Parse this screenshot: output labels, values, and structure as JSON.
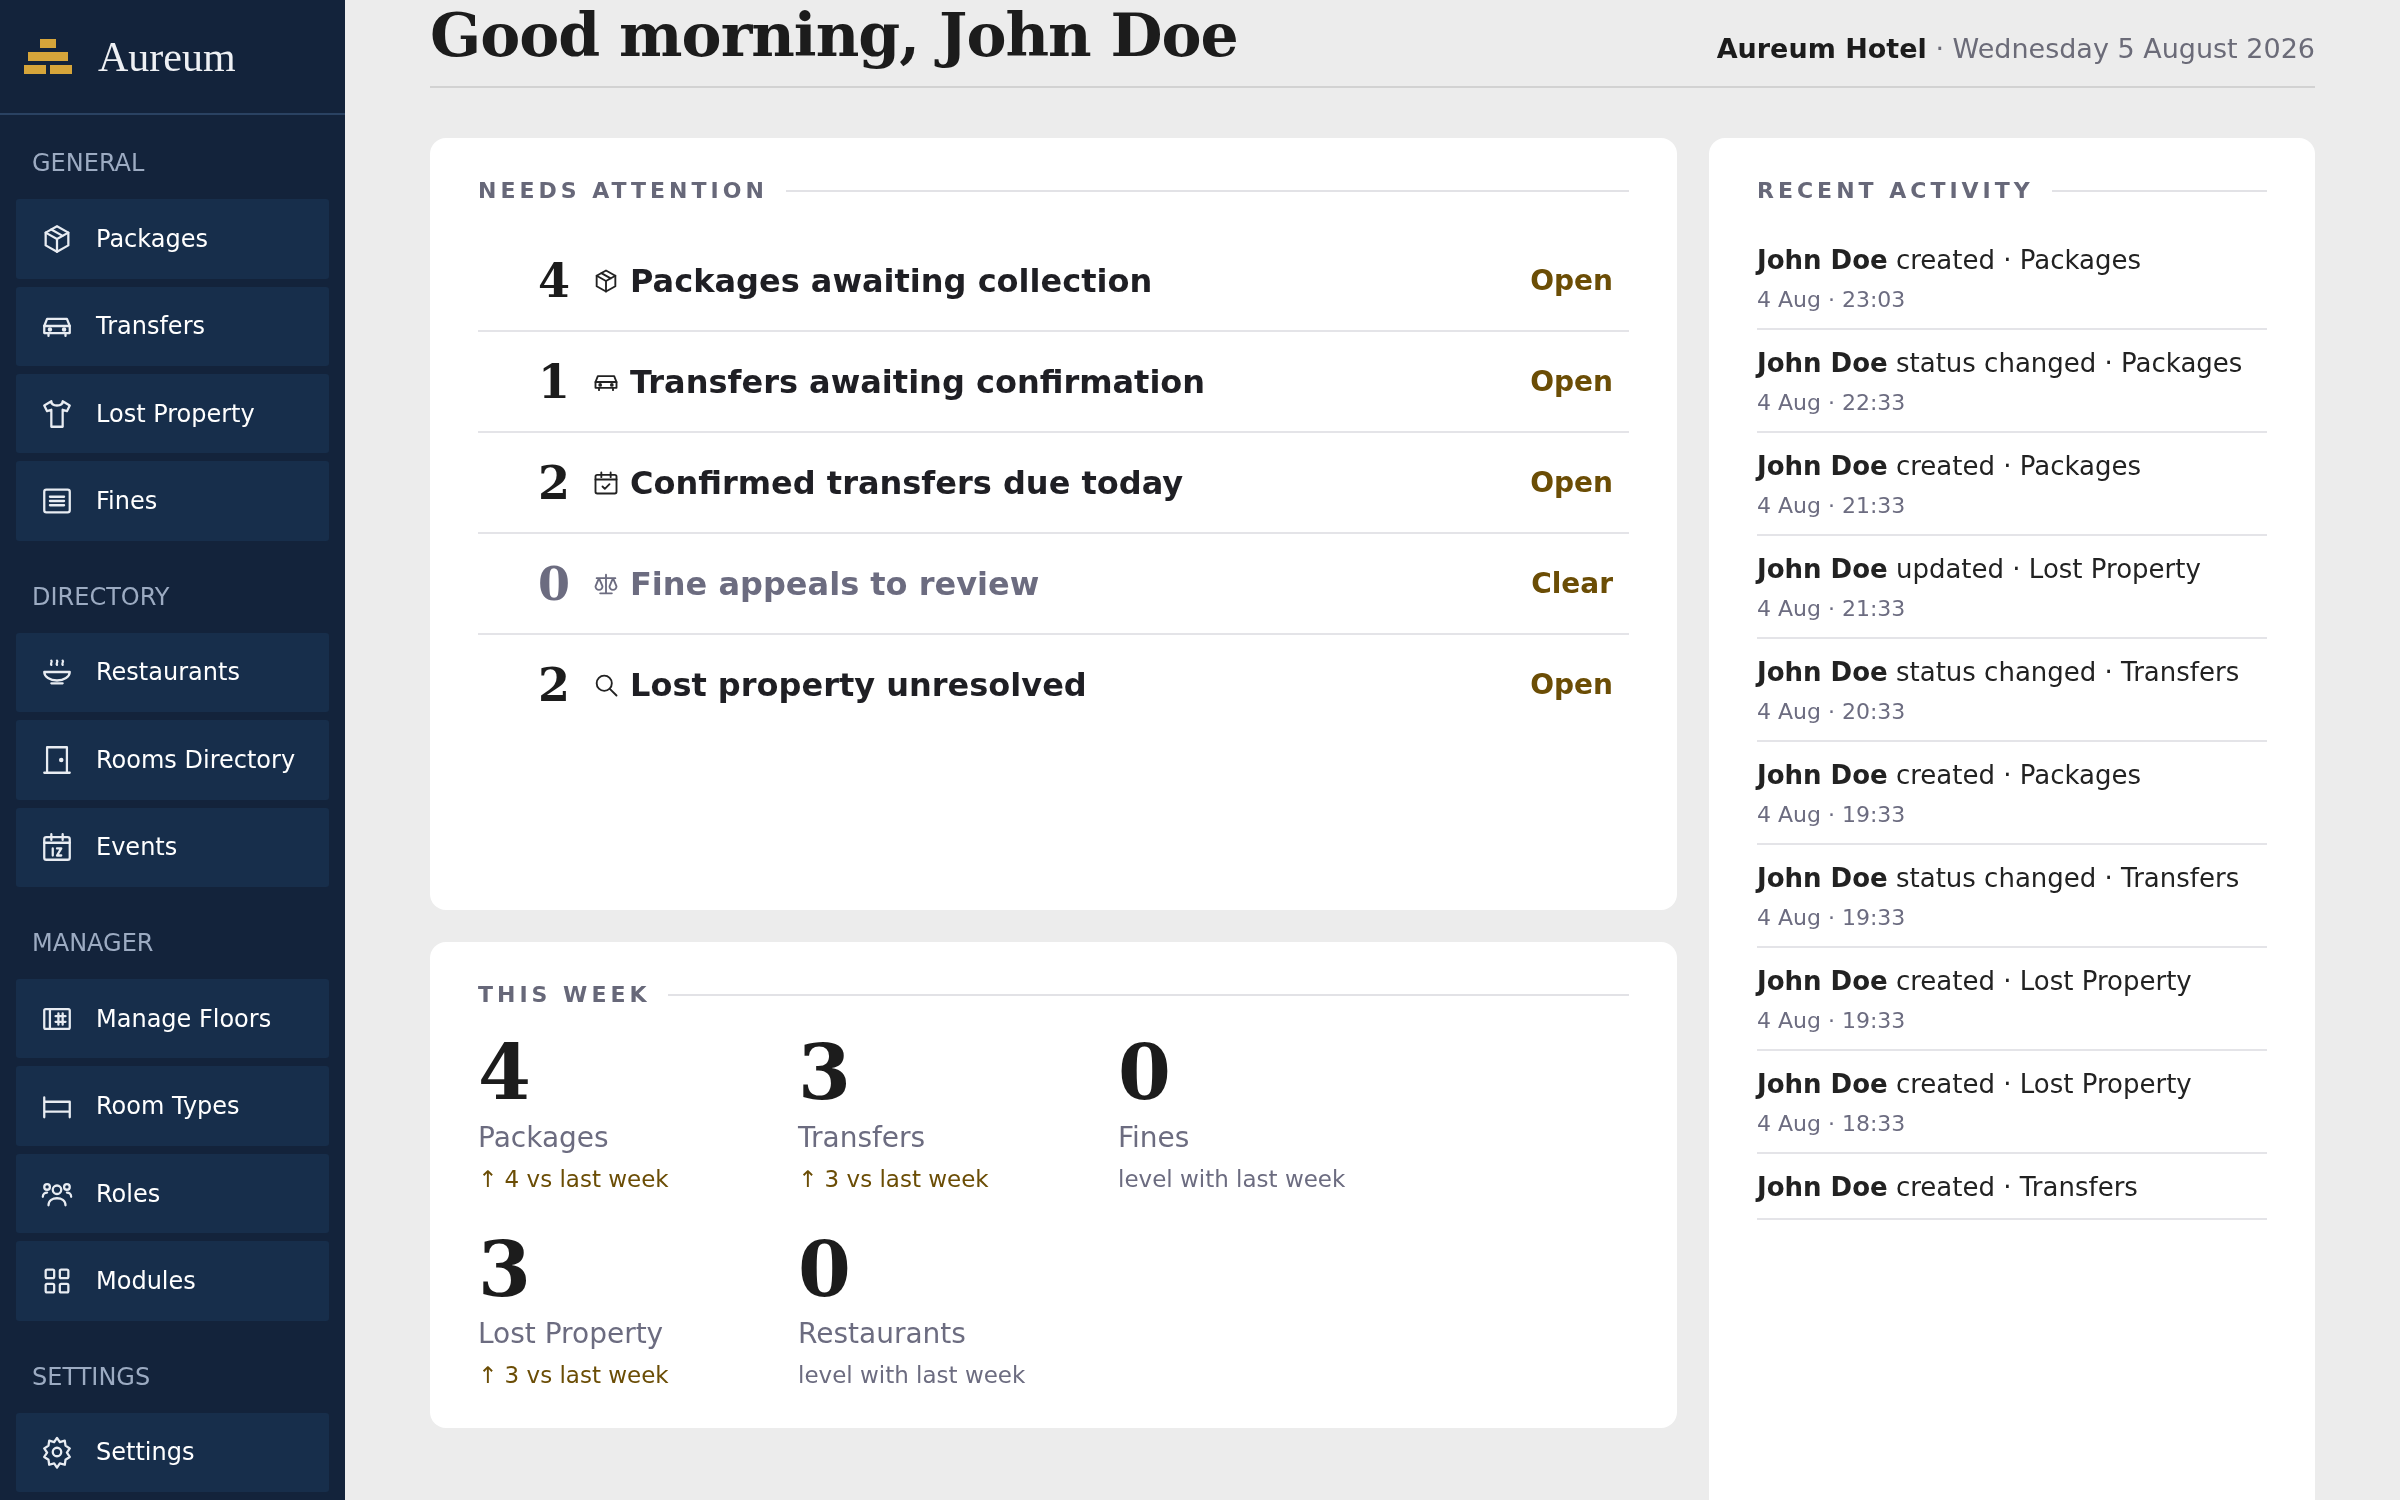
{
  "sidebar": {
    "brand": "Aureum",
    "sections": [
      {
        "title": "GENERAL",
        "items": [
          {
            "label": "Packages"
          },
          {
            "label": "Transfers"
          },
          {
            "label": "Lost Property"
          },
          {
            "label": "Fines"
          }
        ]
      },
      {
        "title": "DIRECTORY",
        "items": [
          {
            "label": "Restaurants"
          },
          {
            "label": "Rooms Directory"
          },
          {
            "label": "Events"
          }
        ]
      },
      {
        "title": "MANAGER",
        "items": [
          {
            "label": "Manage Floors"
          },
          {
            "label": "Room Types"
          },
          {
            "label": "Roles"
          },
          {
            "label": "Modules"
          }
        ]
      },
      {
        "title": "SETTINGS",
        "items": [
          {
            "label": "Settings"
          }
        ]
      }
    ]
  },
  "header": {
    "greeting": "Good morning, John Doe",
    "context": "**Aureum Hotel** · Wednesday 5 August 2026"
  },
  "needs_attention": {
    "title": "NEEDS ATTENTION",
    "rows": [
      {
        "count": "4",
        "label": "Packages awaiting collection",
        "action": "Open",
        "muted": false
      },
      {
        "count": "1",
        "label": "Transfers awaiting confirmation",
        "action": "Open",
        "muted": false
      },
      {
        "count": "2",
        "label": "Confirmed transfers due today",
        "action": "Open",
        "muted": false
      },
      {
        "count": "0",
        "label": "Fine appeals to review",
        "action": "Clear",
        "muted": true
      },
      {
        "count": "2",
        "label": "Lost property unresolved",
        "action": "Open",
        "muted": false
      }
    ]
  },
  "this_week": {
    "title": "THIS WEEK",
    "stats": [
      {
        "value": "4",
        "label": "Packages",
        "trend": "↑ 4 vs last week",
        "kind": "up"
      },
      {
        "value": "3",
        "label": "Transfers",
        "trend": "↑ 3 vs last week",
        "kind": "up"
      },
      {
        "value": "0",
        "label": "Fines",
        "trend": "level with last week",
        "kind": "level"
      },
      {
        "value": "3",
        "label": "Lost Property",
        "trend": "↑ 3 vs last week",
        "kind": "up"
      },
      {
        "value": "0",
        "label": "Restaurants",
        "trend": "level with last week",
        "kind": "level"
      }
    ]
  },
  "recent_activity": {
    "title": "RECENT ACTIVITY",
    "items": [
      {
        "text": "**John Doe** created · Packages",
        "time": "4 Aug · 23:03"
      },
      {
        "text": "**John Doe** status changed · Packages",
        "time": "4 Aug · 22:33"
      },
      {
        "text": "**John Doe** created · Packages",
        "time": "4 Aug · 21:33"
      },
      {
        "text": "**John Doe** updated · Lost Property",
        "time": "4 Aug · 21:33"
      },
      {
        "text": "**John Doe** status changed · Transfers",
        "time": "4 Aug · 20:33"
      },
      {
        "text": "**John Doe** created · Packages",
        "time": "4 Aug · 19:33"
      },
      {
        "text": "**John Doe** status changed · Transfers",
        "time": "4 Aug · 19:33"
      },
      {
        "text": "**John Doe** created · Lost Property",
        "time": "4 Aug · 19:33"
      },
      {
        "text": "**John Doe** created · Lost Property",
        "time": "4 Aug · 18:33"
      },
      {
        "text": "**John Doe** created · Transfers"
      }
    ]
  }
}
